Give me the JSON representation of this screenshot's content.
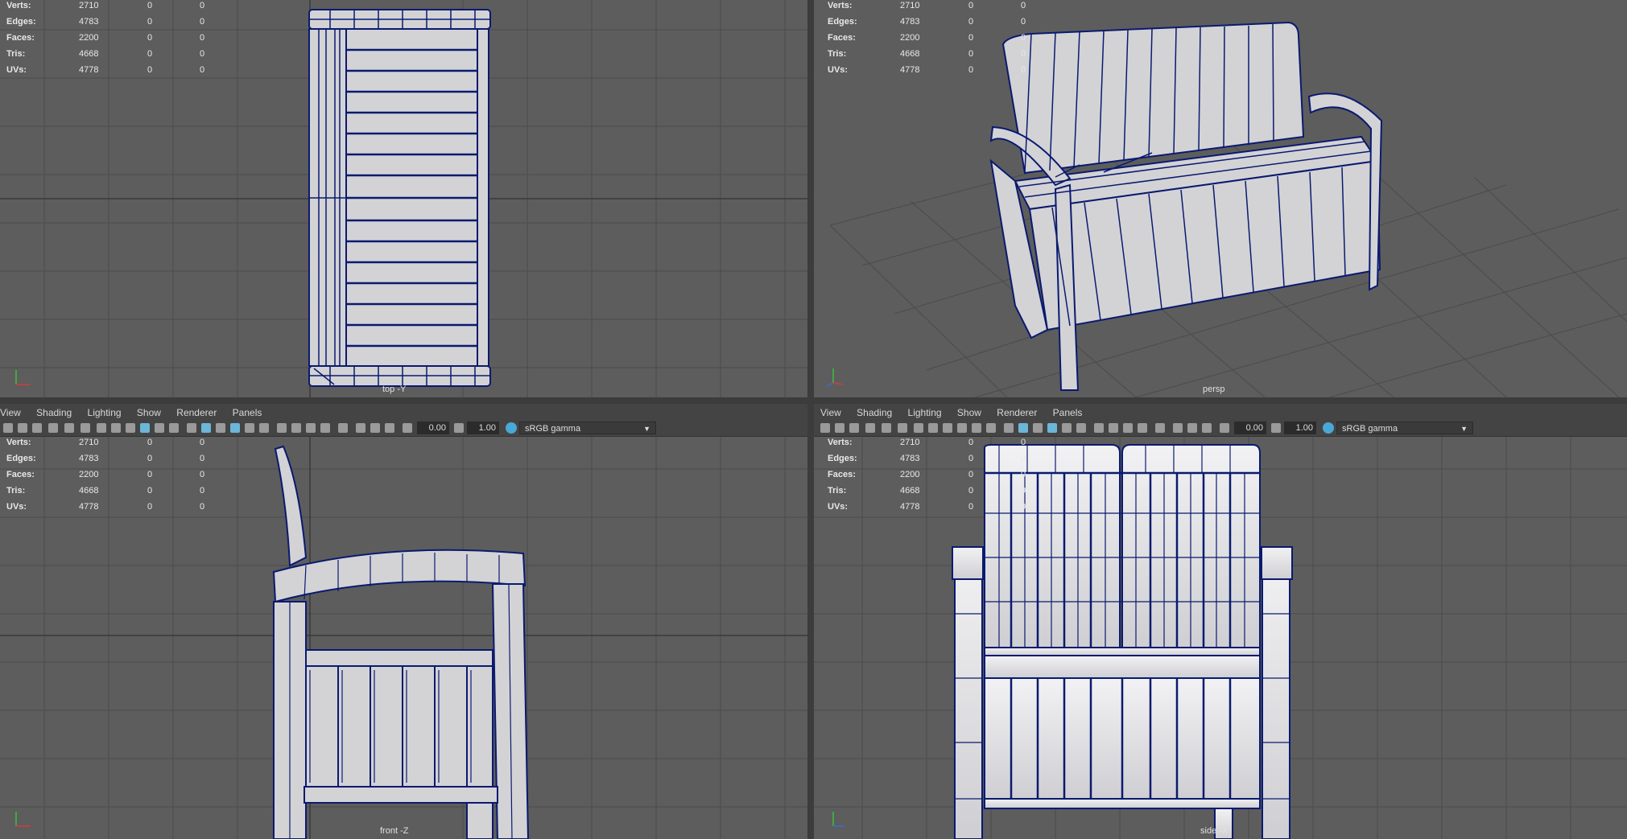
{
  "stats": {
    "rows": [
      {
        "label": "Verts:",
        "v1": "2710",
        "v2": "0",
        "v3": "0"
      },
      {
        "label": "Edges:",
        "v1": "4783",
        "v2": "0",
        "v3": "0"
      },
      {
        "label": "Faces:",
        "v1": "2200",
        "v2": "0",
        "v3": "0"
      },
      {
        "label": "Tris:",
        "v1": "4668",
        "v2": "0",
        "v3": "0"
      },
      {
        "label": "UVs:",
        "v1": "4778",
        "v2": "0",
        "v3": "0"
      }
    ]
  },
  "viewports": {
    "top": {
      "camera": "top -Y"
    },
    "persp": {
      "camera": "persp"
    },
    "front": {
      "camera": "front -Z"
    },
    "side": {
      "camera": "side -X"
    }
  },
  "menu": {
    "items": [
      "View",
      "Shading",
      "Lighting",
      "Show",
      "Renderer",
      "Panels"
    ]
  },
  "toolbar": {
    "exposure": "0.00",
    "gamma": "1.00",
    "colorspace": "sRGB gamma"
  },
  "colors": {
    "wire": "#0a1a6e",
    "surface": "#d3d3d6",
    "background": "#5d5d5d",
    "grid": "#4b4b4b"
  }
}
